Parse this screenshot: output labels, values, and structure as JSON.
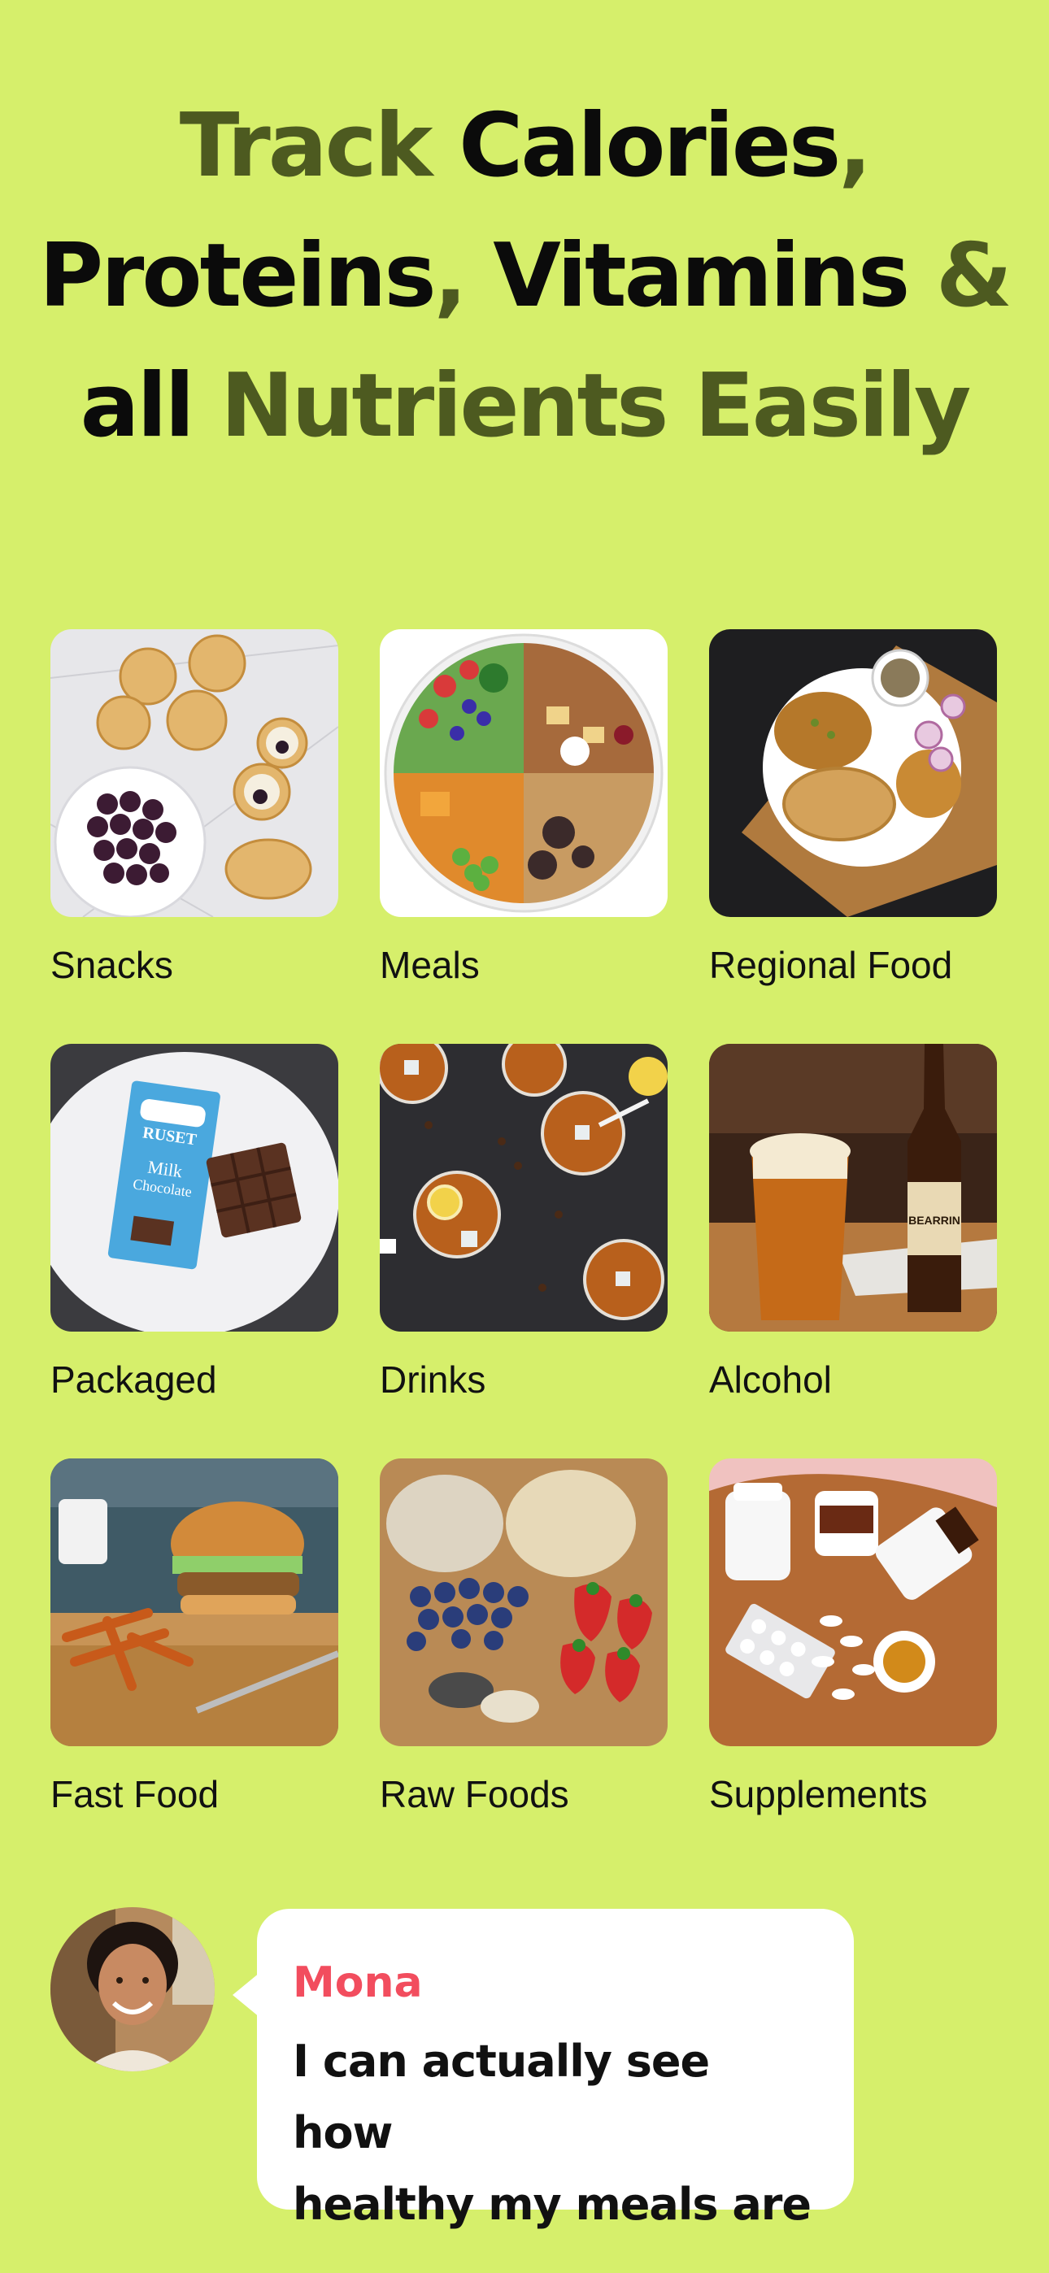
{
  "headline": {
    "part1": "Track ",
    "part2": "Calories",
    "part3": ",",
    "part4": "Proteins",
    "part5": ", ",
    "part6": "Vitamins",
    "part7": " &",
    "part8": "all ",
    "part9": "Nutrients Easily"
  },
  "categories": [
    {
      "label": "Snacks"
    },
    {
      "label": "Meals"
    },
    {
      "label": "Regional Food"
    },
    {
      "label": "Packaged"
    },
    {
      "label": "Drinks"
    },
    {
      "label": "Alcohol"
    },
    {
      "label": "Fast Food"
    },
    {
      "label": "Raw Foods"
    },
    {
      "label": "Supplements"
    }
  ],
  "packaged_wrapper": {
    "brand": "RUSET",
    "line1": "Milk",
    "line2": "Chocolate"
  },
  "beer_label": "BEARRIN",
  "testimonial": {
    "name": "Mona",
    "line1": "I can actually see how",
    "line2": "healthy my meals are"
  },
  "colors": {
    "background": "#d6ef6b",
    "headline_dark": "#0b0b0b",
    "headline_olive": "#4d5a20",
    "name_accent": "#f24d5e"
  }
}
